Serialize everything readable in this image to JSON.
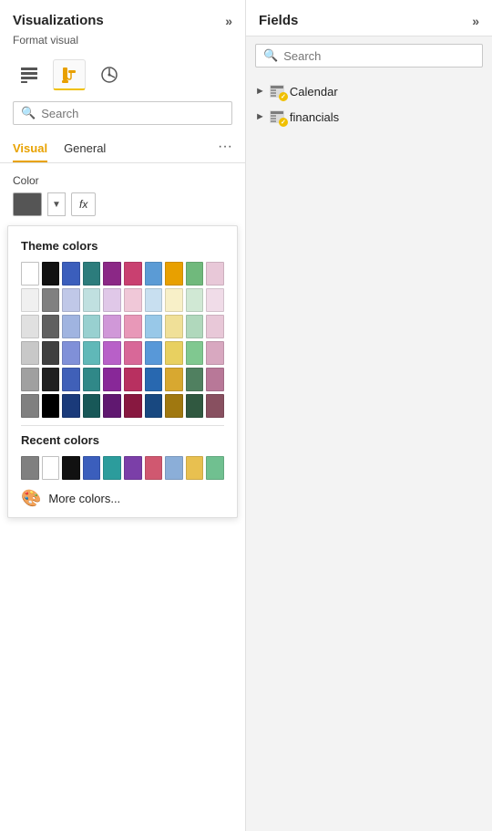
{
  "left_panel": {
    "title": "Visualizations",
    "format_label": "Format visual",
    "toolbar": {
      "icon1_label": "table-icon",
      "icon2_label": "paint-brush-icon",
      "icon3_label": "analytics-icon"
    },
    "search_placeholder": "Search",
    "tabs": [
      {
        "id": "visual",
        "label": "Visual",
        "active": true
      },
      {
        "id": "general",
        "label": "General",
        "active": false
      }
    ],
    "more_label": "···",
    "color_section": {
      "label": "Color",
      "fx_label": "fx"
    },
    "color_picker": {
      "theme_title": "Theme colors",
      "theme_rows": [
        [
          "#ffffff",
          "#111111",
          "#3B5EBC",
          "#2C7C7C",
          "#8B2886",
          "#C94070",
          "#5B9BD5",
          "#E8A000",
          "#70B97C",
          "#E8C8D8"
        ],
        [
          "#f0f0f0",
          "#808080",
          "#c0c8e8",
          "#c0e0e0",
          "#e0c0e0",
          "#f0c8d8",
          "#c8dff0",
          "#f8f0c8",
          "#d0e8d4",
          "#f0dce8"
        ],
        [
          "#e0e0e0",
          "#606060",
          "#a0b0e0",
          "#98d0d0",
          "#d098d8",
          "#e898b8",
          "#98c8e8",
          "#f0e098",
          "#b0d8bc",
          "#e8c8d8"
        ],
        [
          "#c8c8c8",
          "#404040",
          "#8090d8",
          "#60b8b8",
          "#b860c8",
          "#d86898",
          "#5898d8",
          "#e8d060",
          "#80c890",
          "#d8a8c0"
        ],
        [
          "#a0a0a0",
          "#202020",
          "#4060b8",
          "#308888",
          "#882898",
          "#b83060",
          "#2868b0",
          "#d8a830",
          "#508060",
          "#b87898"
        ],
        [
          "#808080",
          "#000000",
          "#1a3a7a",
          "#185858",
          "#601870",
          "#881840",
          "#184880",
          "#a07810",
          "#305840",
          "#885060"
        ]
      ],
      "recent_title": "Recent colors",
      "recent_colors": [
        "#808080",
        "#ffffff",
        "#111111",
        "#3B5EBC",
        "#2C9C9C",
        "#7B3FA8",
        "#D05870",
        "#8BAED8",
        "#E8C050",
        "#70C090"
      ],
      "more_colors_label": "More colors..."
    }
  },
  "right_panel": {
    "title": "Fields",
    "search_placeholder": "Search",
    "fields": [
      {
        "id": "calendar",
        "label": "Calendar",
        "has_badge": true
      },
      {
        "id": "financials",
        "label": "financials",
        "has_badge": true
      }
    ]
  }
}
